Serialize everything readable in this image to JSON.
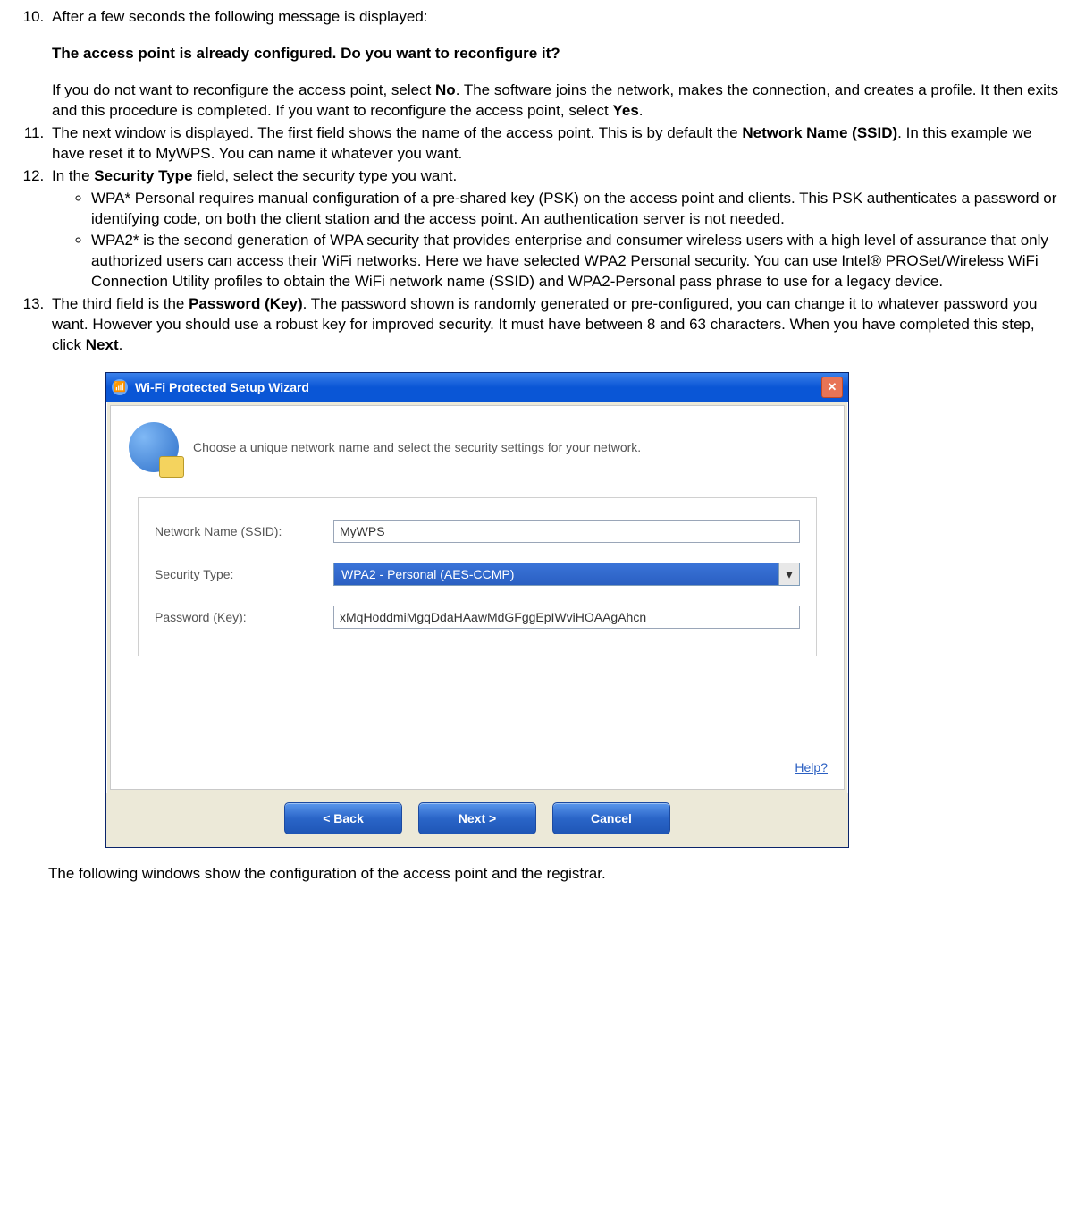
{
  "list": {
    "item10": {
      "line1": "After a few seconds the following message is displayed:",
      "bold": "The access point is already configured. Do you want to reconfigure it?",
      "rest_a": "If you do not want to reconfigure the access point, select ",
      "no": "No",
      "rest_b": ". The software joins the network, makes the connection, and creates a profile. It then exits and this procedure is completed. If you want to reconfigure the access point, select ",
      "yes": "Yes",
      "rest_c": "."
    },
    "item11": {
      "a": "The next window is displayed. The first field shows the name of the access point. This is by default the ",
      "bold": "Network Name (SSID)",
      "b": ". In this example we have reset it to MyWPS. You can name it whatever you want."
    },
    "item12": {
      "a": "In the ",
      "bold": "Security Type",
      "b": " field, select the security type you want.",
      "sub1": "WPA* Personal requires manual configuration of a pre-shared key (PSK) on the access point and clients. This PSK authenticates a password or identifying code, on both the client station and the access point. An authentication server is not needed.",
      "sub2": "WPA2* is the second generation of WPA security that provides enterprise and consumer wireless users with a high level of assurance that only authorized users can access their WiFi networks. Here we have selected WPA2 Personal security. You can use Intel® PROSet/Wireless WiFi Connection Utility profiles to obtain the WiFi network name (SSID) and WPA2-Personal pass phrase to use for a legacy device."
    },
    "item13": {
      "a": "The third field is the ",
      "bold": "Password (Key)",
      "b": ". The password shown is randomly generated or pre-configured, you can change it to whatever password you want. However you should use a robust key for improved security. It must have between 8 and 63 characters. When you have completed this step, click ",
      "next": "Next",
      "c": "."
    }
  },
  "dialog": {
    "title": "Wi-Fi Protected Setup Wizard",
    "intro": "Choose a unique network name and select the security settings for your network.",
    "labels": {
      "ssid": "Network Name (SSID):",
      "sectype": "Security Type:",
      "password": "Password (Key):"
    },
    "values": {
      "ssid": "MyWPS",
      "sectype": "WPA2 - Personal (AES-CCMP)",
      "password": "xMqHoddmiMgqDdaHAawMdGFggEpIWviHOAAgAhcn"
    },
    "help": "Help?",
    "buttons": {
      "back": "<  Back",
      "next": "Next  >",
      "cancel": "Cancel"
    }
  },
  "following": "The following windows show the configuration of the access point and the registrar."
}
